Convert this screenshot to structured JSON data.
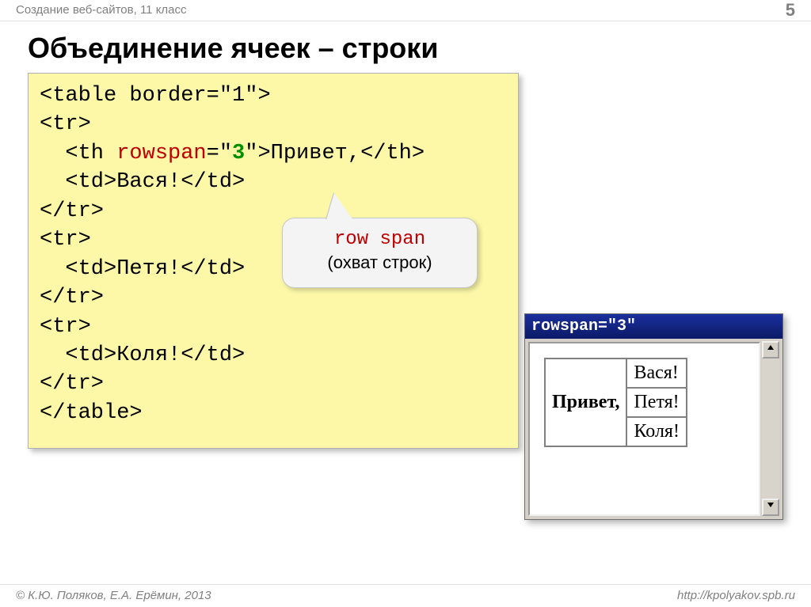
{
  "header": {
    "course": "Создание веб-сайтов, 11 класс",
    "page_number": "5"
  },
  "title": "Объединение ячеек – строки",
  "code": {
    "line1_open": "<table border=\"1\">",
    "tr_open": "<tr>",
    "th_open": "  <th ",
    "rowspan_attr": "rowspan",
    "eq": "=\"",
    "rowspan_val": "3",
    "th_rest": "\">Привет,</th>",
    "td_vasya": "  <td>Вася!</td>",
    "tr_close": "</tr>",
    "td_petya": "  <td>Петя!</td>",
    "td_kolya": "  <td>Коля!</td>",
    "table_close": "</table>"
  },
  "callout": {
    "line1": "row span",
    "line2": "(охват строк)"
  },
  "browser": {
    "title": "rowspan=\"3\"",
    "th": "Привет,",
    "td1": "Вася!",
    "td2": "Петя!",
    "td3": "Коля!"
  },
  "footer": {
    "copyright": "© К.Ю. Поляков, Е.А. Ерёмин, 2013",
    "url": "http://kpolyakov.spb.ru"
  }
}
